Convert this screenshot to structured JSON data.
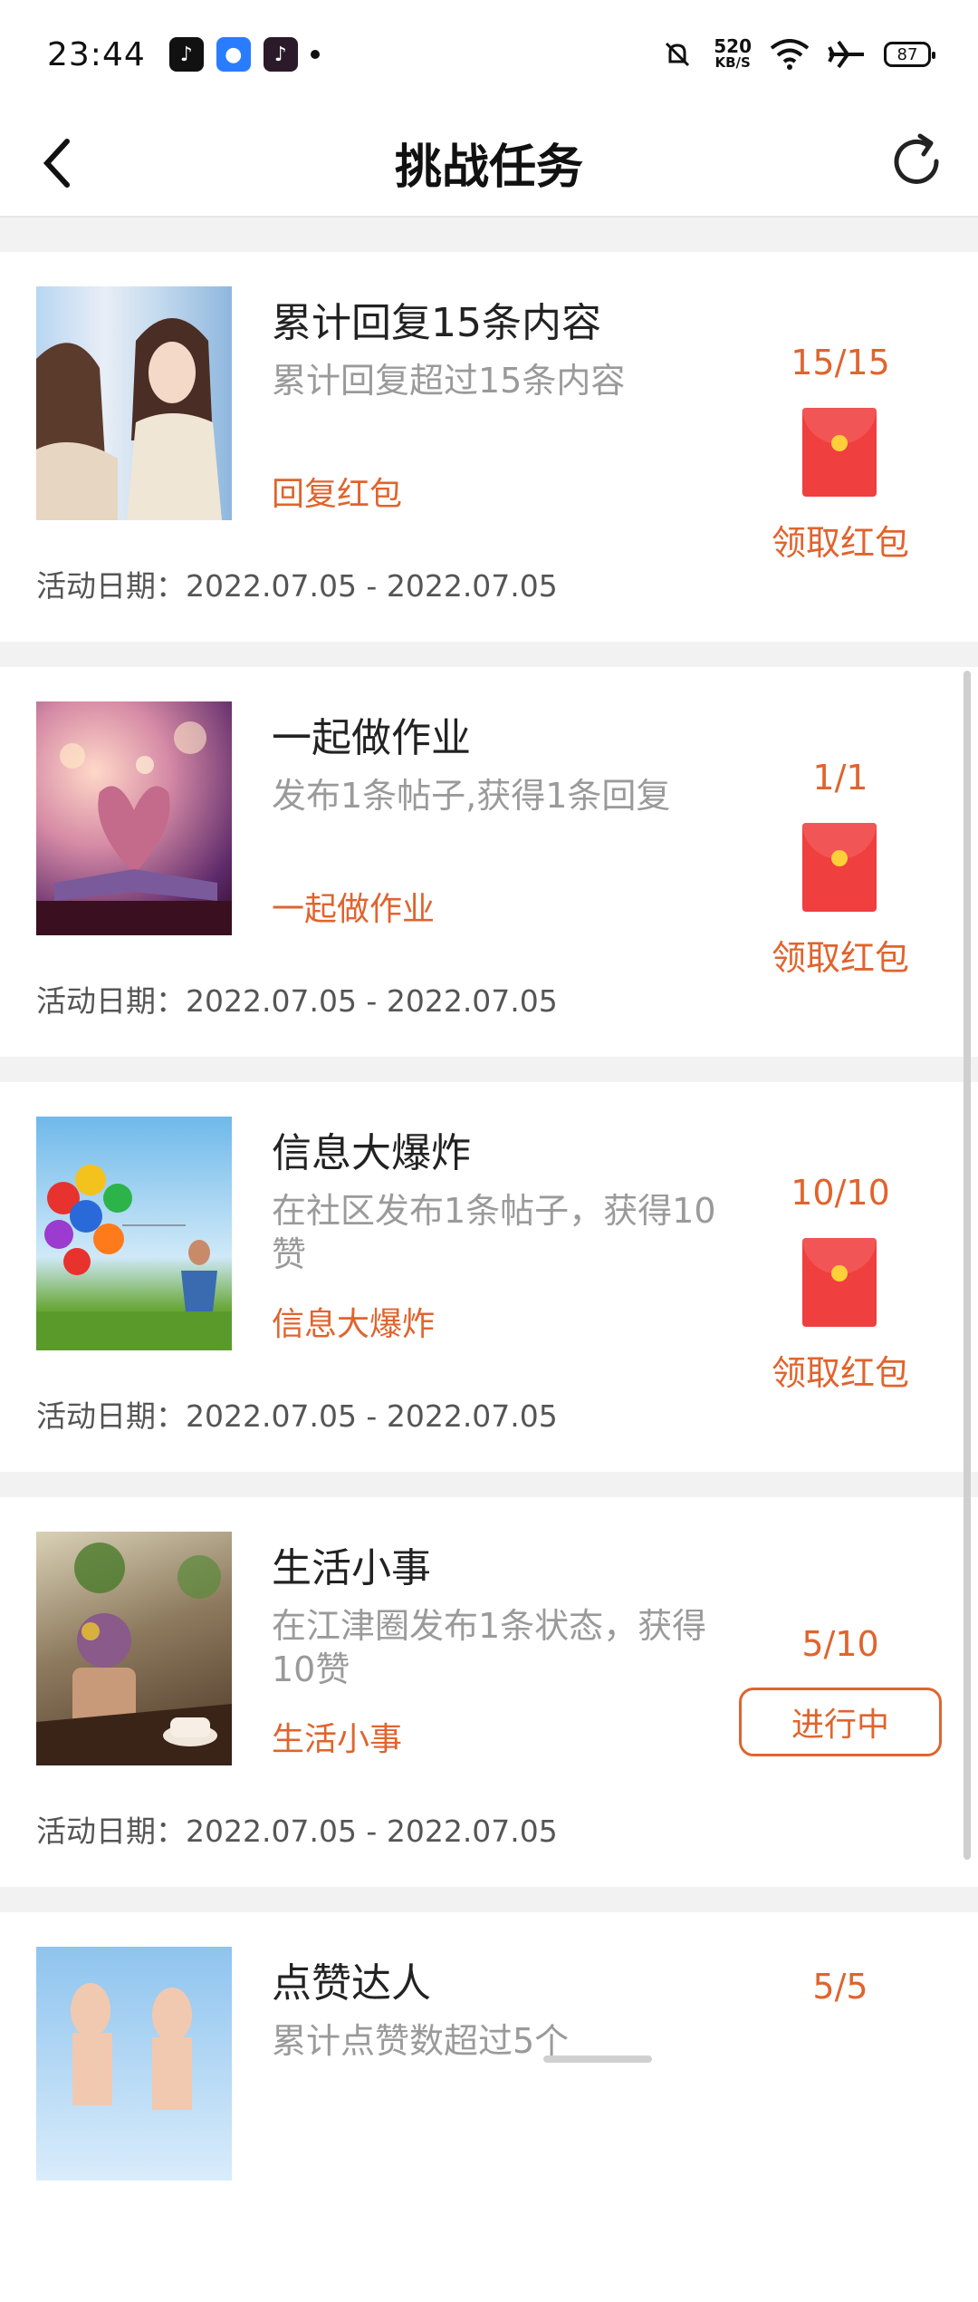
{
  "status": {
    "time": "23:44",
    "net_speed": "520",
    "net_unit": "KB/S",
    "battery": "87"
  },
  "header": {
    "title": "挑战任务"
  },
  "tasks": [
    {
      "title": "累计回复15条内容",
      "desc": "累计回复超过15条内容",
      "tag": "回复红包",
      "date": "活动日期：2022.07.05 - 2022.07.05",
      "progress": "15/15",
      "action": "领取红包",
      "state": "completed"
    },
    {
      "title": "一起做作业",
      "desc": "发布1条帖子,获得1条回复",
      "tag": "一起做作业",
      "date": "活动日期：2022.07.05 - 2022.07.05",
      "progress": "1/1",
      "action": "领取红包",
      "state": "completed"
    },
    {
      "title": "信息大爆炸",
      "desc": "在社区发布1条帖子，获得10赞",
      "tag": "信息大爆炸",
      "date": "活动日期：2022.07.05 - 2022.07.05",
      "progress": "10/10",
      "action": "领取红包",
      "state": "completed"
    },
    {
      "title": "生活小事",
      "desc": "在江津圈发布1条状态，获得10赞",
      "tag": "生活小事",
      "date": "活动日期：2022.07.05 - 2022.07.05",
      "progress": "5/10",
      "action": "进行中",
      "state": "in-progress"
    },
    {
      "title": "点赞达人",
      "desc": "累计点赞数超过5个",
      "progress": "5/5"
    }
  ],
  "colors": {
    "accent": "#e0642e",
    "redpacket": "#ef3f3f"
  }
}
